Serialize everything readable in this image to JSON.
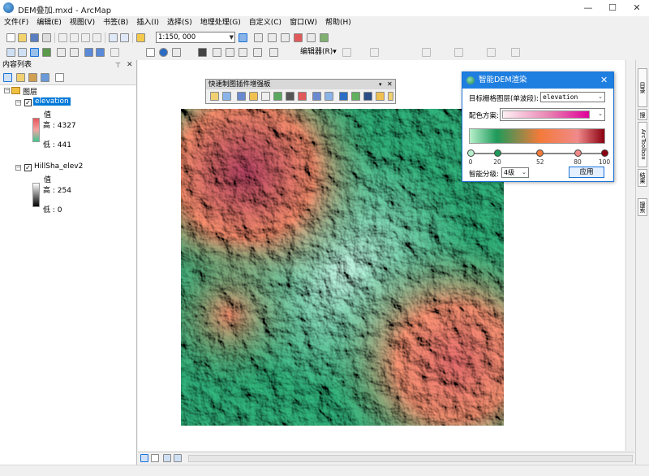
{
  "window": {
    "title": "DEM叠加.mxd - ArcMap",
    "minimize": "—",
    "maximize": "☐",
    "close": "✕"
  },
  "menu": [
    "文件(F)",
    "编辑(E)",
    "视图(V)",
    "书签(B)",
    "插入(I)",
    "选择(S)",
    "地理处理(G)",
    "自定义(C)",
    "窗口(W)",
    "帮助(H)"
  ],
  "toolbar": {
    "scale": "1:150, 000",
    "editor": "编辑器(R)▾"
  },
  "toc": {
    "title": "内容列表",
    "pin": "⊤",
    "close": "✕",
    "root": "图层",
    "layers": [
      {
        "name": "elevation",
        "value_label": "值",
        "high": "高 : 4327",
        "low": "低 : 441"
      },
      {
        "name": "HillSha_elev2",
        "value_label": "值",
        "high": "高 : 254",
        "low": "低 : 0"
      }
    ]
  },
  "quick_panel": {
    "title": "快速制图插件增强板"
  },
  "dialog": {
    "title": "智能DEM渲染",
    "close": "✕",
    "target_label": "目标栅格图层(单波段):",
    "target_value": "elevation",
    "scheme_label": "配色方案:",
    "class_label": "智能分级:",
    "class_value": "4级",
    "apply_label": "应用",
    "stops": [
      {
        "label": "0",
        "color": "#b8f0cc",
        "pos": 0
      },
      {
        "label": "20",
        "color": "#1e9a5a",
        "pos": 20
      },
      {
        "label": "52",
        "color": "#f47a3a",
        "pos": 52
      },
      {
        "label": "80",
        "color": "#f08a8a",
        "pos": 80
      },
      {
        "label": "100",
        "color": "#8b0010",
        "pos": 100
      }
    ]
  },
  "right_dock": [
    "目录",
    "搜索",
    "ArcToolbox",
    "结果",
    "搜索"
  ],
  "colors": {
    "accent": "#1f7fe0",
    "selection": "#0078d7"
  }
}
